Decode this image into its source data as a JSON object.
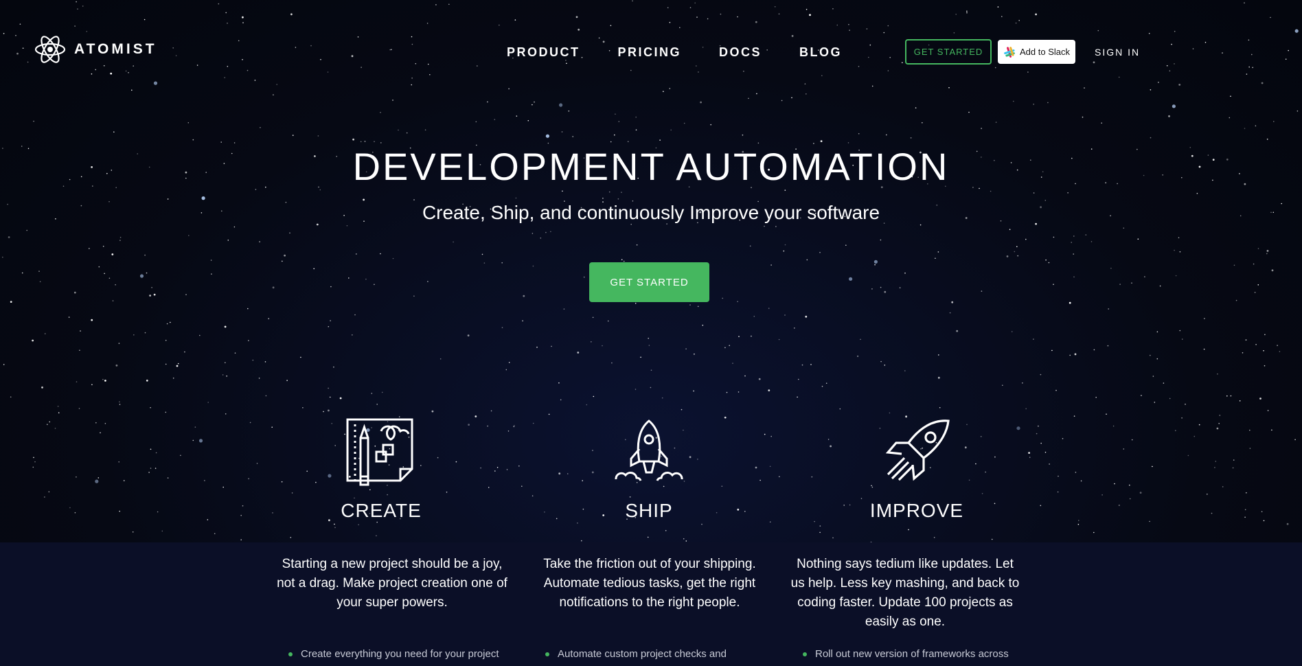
{
  "header": {
    "logo_text": "ATOMIST",
    "nav": [
      "PRODUCT",
      "PRICING",
      "DOCS",
      "BLOG"
    ],
    "get_started_label": "GET STARTED",
    "slack_label": "Add to Slack",
    "signin_label": "SIGN IN"
  },
  "hero": {
    "title": "DEVELOPMENT AUTOMATION",
    "subtitle": "Create, Ship, and continuously Improve your software",
    "cta_label": "GET STARTED"
  },
  "features": [
    {
      "title": "CREATE",
      "icon": "blueprint-pencil-icon",
      "description": "Starting a new project should be a joy, not a drag. Make project creation one of your super powers.",
      "bullet": "Create everything you need for your project"
    },
    {
      "title": "SHIP",
      "icon": "rocket-launch-icon",
      "description": "Take the friction out of your shipping. Automate tedious tasks, get the right notifications to the right people.",
      "bullet": "Automate custom project checks and"
    },
    {
      "title": "IMPROVE",
      "icon": "rocket-flying-icon",
      "description": "Nothing says tedium like updates. Let us help. Less key mashing, and back to coding faster. Update 100 projects as easily as one.",
      "bullet": "Roll out new version of frameworks across"
    }
  ],
  "colors": {
    "accent": "#45b75f",
    "background": "#070a18",
    "lower_band": "#0b0f27"
  }
}
